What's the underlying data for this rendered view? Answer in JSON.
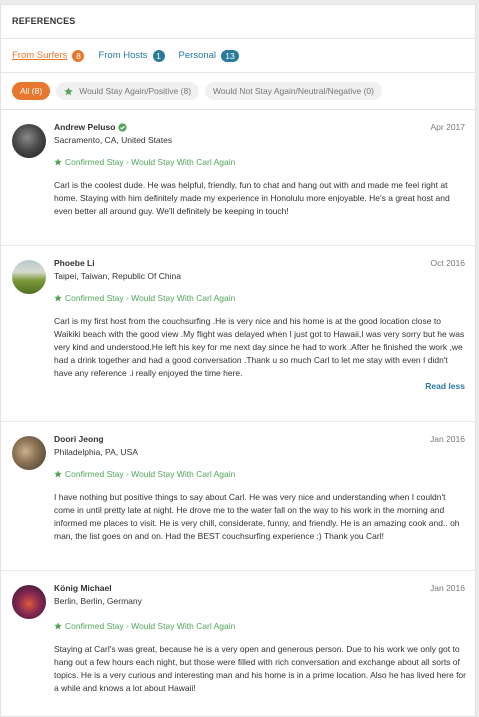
{
  "header": {
    "title": "REFERENCES"
  },
  "tabs": [
    {
      "label": "From Surfers",
      "count": "8"
    },
    {
      "label": "From Hosts",
      "count": "1"
    },
    {
      "label": "Personal",
      "count": "13"
    }
  ],
  "filters": [
    {
      "label": "All (8)"
    },
    {
      "label": "Would Stay Again/Positive (8)",
      "icon": "star-icon"
    },
    {
      "label": "Would Not Stay Again/Neutral/Negative (0)"
    }
  ],
  "reviews": [
    {
      "name": "Andrew Peluso",
      "verified": true,
      "location": "Sacramento, CA, United States",
      "date": "Apr 2017",
      "confirmation": "Confirmed Stay - Would Stay With Carl Again",
      "text": "Carl is the coolest dude. He was helpful, friendly, fun to chat and hang out with and made me feel right at home. Staying with him definitely made my experience in Honolulu more enjoyable. He's a great host and even better all around guy. We'll definitely be keeping in touch!"
    },
    {
      "name": "Phoebe Li",
      "location": "Taipei, Taiwan, Republic Of China",
      "date": "Oct 2016",
      "confirmation": "Confirmed Stay - Would Stay With Carl Again",
      "text": "Carl is my first host from the couchsurfing .He is very nice and his home is at the good location close to Waikiki beach with the good view .My flight was delayed when I just got to Hawaii,I was very sorry but he was very kind and understood.He left his key for me next day since he had to work .After he finished the work ,we had a drink together and had a good conversation .Thank u so much Carl to let me stay with even I didn't have any reference .i really enjoyed the time here.",
      "read_less": "Read less"
    },
    {
      "name": "Doori Jeong",
      "location": "Philadelphia, PA, USA",
      "date": "Jan 2016",
      "confirmation": "Confirmed Stay - Would Stay With Carl Again",
      "text": "I have nothing but positive things to say about Carl. He was very nice and understanding when I couldn't come in until pretty late at night. He drove me to the water fall on the way to his work in the morning and informed me places to visit. He is very chill, considerate, funny, and friendly. He is an amazing cook and.. oh man, the list goes on and on. Had the BEST couchsurfing experience :) Thank you Carl!"
    },
    {
      "name": "König Michael",
      "location": "Berlin, Berlin, Germany",
      "date": "Jan 2016",
      "confirmation": "Confirmed Stay - Would Stay With Carl Again",
      "text": "Staying at Carl's was great, because he is a very open and generous person. Due to his work we only got to hang out a few hours each night, but those were filled with rich conversation and exchange about all sorts of topics. He is a very curious and interesting man and his home is in a prime location. Also he has lived here for a while and knows a lot about Hawaii!"
    }
  ],
  "colors": {
    "accent": "#e8772e",
    "link": "#2678a5",
    "confirm": "#52a55a",
    "badge": "#2b7a9c"
  }
}
